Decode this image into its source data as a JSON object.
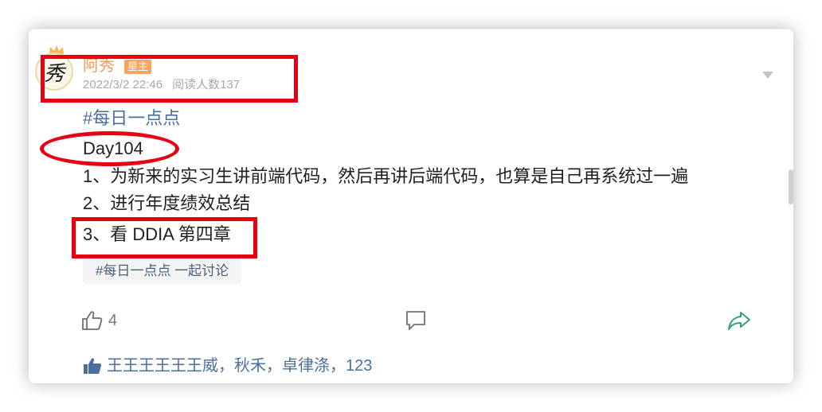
{
  "post": {
    "author": {
      "name": "阿秀",
      "role_badge": "星主",
      "avatar_glyph": "秀"
    },
    "timestamp": "2022/3/2 22:46",
    "read_count": "阅读人数137",
    "hashtag": "#每日一点点",
    "lines": [
      "Day104",
      "1、为新来的实习生讲前端代码，然后再讲后端代码，也算是自己再系统过一遍",
      "2、进行年度绩效总结",
      "3、看 DDIA 第四章"
    ],
    "topic_chip": "#每日一点点 一起讨论",
    "actions": {
      "like_count": "4",
      "like_icon": "thumbs-up-icon",
      "comment_icon": "comment-icon",
      "share_icon": "share-icon"
    },
    "likers": {
      "icon": "thumbs-up-filled-icon",
      "names": [
        "王王王王王王威",
        "秋禾",
        "卓律涤",
        "123"
      ],
      "separator": "，"
    }
  },
  "colors": {
    "author_name": "#f29a55",
    "badge_bg": "#f7a65c",
    "link_blue": "#4a6ea0",
    "annotation_red": "#e60012",
    "share_green": "#2fa37b"
  }
}
